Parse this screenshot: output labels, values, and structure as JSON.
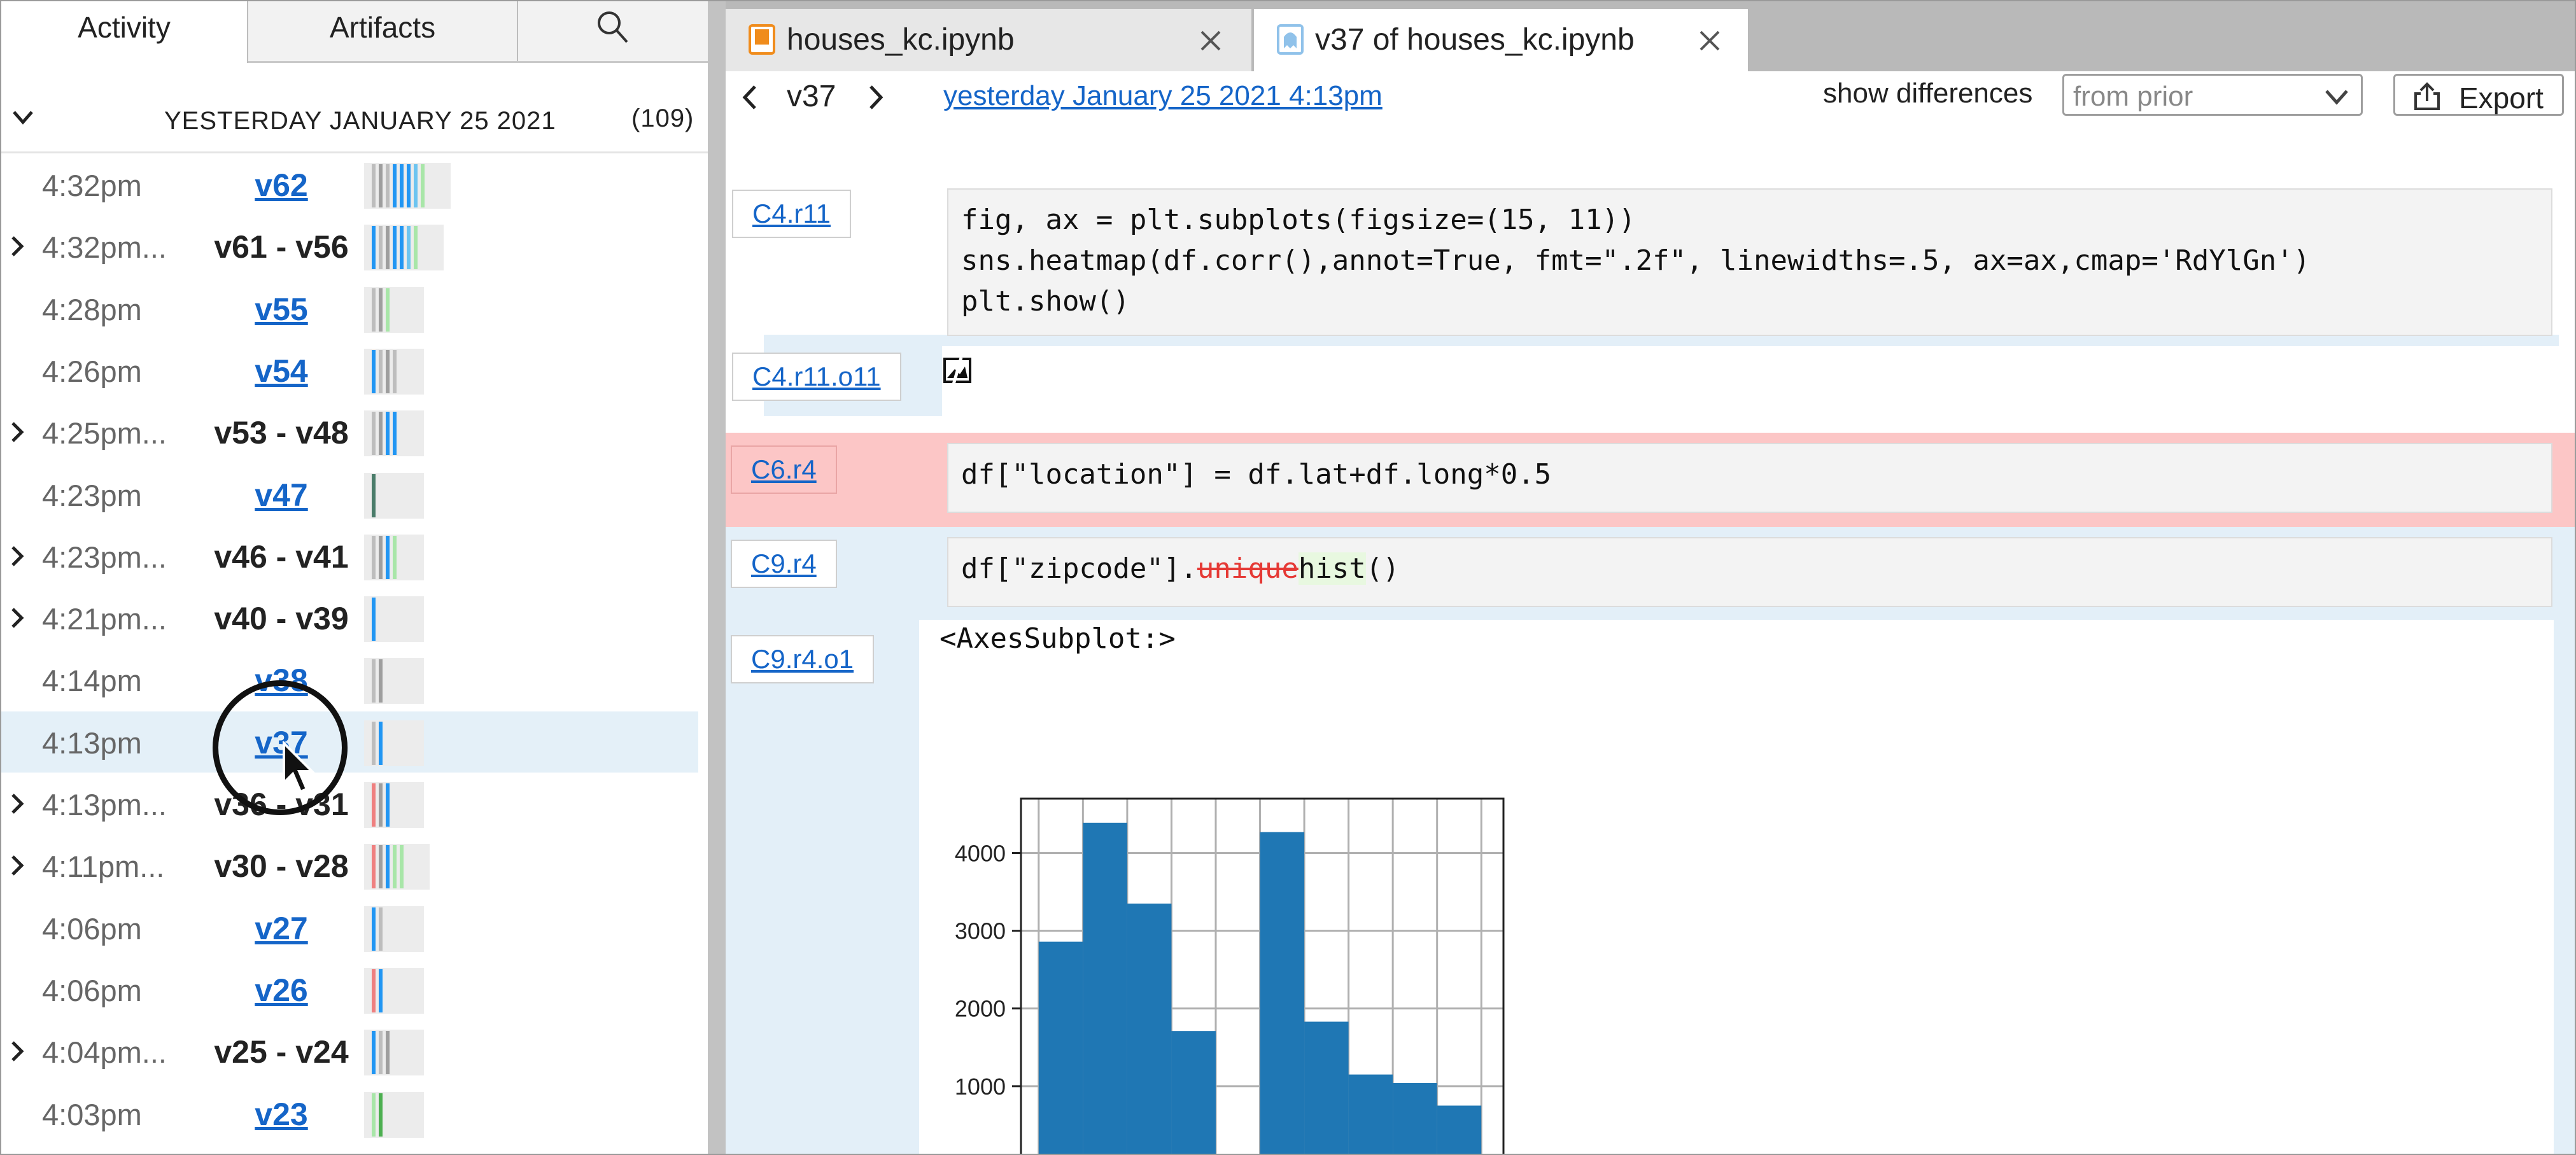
{
  "left_panel": {
    "tabs": {
      "activity": "Activity",
      "artifacts": "Artifacts",
      "search_icon": "search-icon"
    },
    "day_header": {
      "label": "YESTERDAY JANUARY 25 2021",
      "count": "(109)"
    },
    "rows": [
      {
        "time": "4:32pm",
        "version": "v62",
        "kind": "single",
        "expandable": false,
        "spark": [
          {
            "c": "#bdbdbd"
          },
          {
            "c": "#9e9e9e"
          },
          {
            "c": "#bdbdbd"
          },
          {
            "c": "#2196f3"
          },
          {
            "c": "#2196f3"
          },
          {
            "c": "#2196f3"
          },
          {
            "c": "#6cc4f0"
          },
          {
            "c": "#a8e6a8"
          }
        ]
      },
      {
        "time": "4:32pm...",
        "version": "v61 - v56",
        "kind": "range",
        "expandable": true,
        "spark": [
          {
            "c": "#2196f3"
          },
          {
            "c": "#bdbdbd"
          },
          {
            "c": "#9e9e9e"
          },
          {
            "c": "#2196f3"
          },
          {
            "c": "#2196f3"
          },
          {
            "c": "#6cc4f0"
          },
          {
            "c": "#a8e6a8"
          }
        ]
      },
      {
        "time": "4:28pm",
        "version": "v55",
        "kind": "single",
        "expandable": false,
        "spark": [
          {
            "c": "#bdbdbd"
          },
          {
            "c": "#9e9e9e"
          },
          {
            "c": "#a8e6a8"
          }
        ]
      },
      {
        "time": "4:26pm",
        "version": "v54",
        "kind": "single",
        "expandable": false,
        "spark": [
          {
            "c": "#2196f3"
          },
          {
            "c": "#bdbdbd"
          },
          {
            "c": "#9e9e9e"
          },
          {
            "c": "#bdbdbd"
          }
        ]
      },
      {
        "time": "4:25pm...",
        "version": "v53 - v48",
        "kind": "range",
        "expandable": true,
        "spark": [
          {
            "c": "#bdbdbd"
          },
          {
            "c": "#9e9e9e"
          },
          {
            "c": "#2196f3"
          },
          {
            "c": "#2196f3"
          }
        ]
      },
      {
        "time": "4:23pm",
        "version": "v47",
        "kind": "single",
        "expandable": false,
        "spark": [
          {
            "c": "#4a7c6a"
          }
        ]
      },
      {
        "time": "4:23pm...",
        "version": "v46 - v41",
        "kind": "range",
        "expandable": true,
        "spark": [
          {
            "c": "#bdbdbd"
          },
          {
            "c": "#9e9e9e"
          },
          {
            "c": "#2196f3"
          },
          {
            "c": "#a8e6a8"
          }
        ]
      },
      {
        "time": "4:21pm...",
        "version": "v40 - v39",
        "kind": "range",
        "expandable": true,
        "spark": [
          {
            "c": "#2196f3"
          }
        ]
      },
      {
        "time": "4:14pm",
        "version": "v38",
        "kind": "single",
        "expandable": false,
        "spark": [
          {
            "c": "#bdbdbd"
          },
          {
            "c": "#9e9e9e"
          }
        ]
      },
      {
        "time": "4:13pm",
        "version": "v37",
        "kind": "single",
        "expandable": false,
        "selected": true,
        "spark": [
          {
            "c": "#bdbdbd"
          },
          {
            "c": "#2196f3"
          }
        ]
      },
      {
        "time": "4:13pm...",
        "version": "v36 - v31",
        "kind": "range",
        "expandable": true,
        "spark": [
          {
            "c": "#ef8080"
          },
          {
            "c": "#9e9e9e"
          },
          {
            "c": "#2196f3"
          }
        ]
      },
      {
        "time": "4:11pm...",
        "version": "v30 - v28",
        "kind": "range",
        "expandable": true,
        "spark": [
          {
            "c": "#ef8080"
          },
          {
            "c": "#9e9e9e"
          },
          {
            "c": "#2196f3"
          },
          {
            "c": "#a8e6a8"
          },
          {
            "c": "#a8e6a8"
          }
        ]
      },
      {
        "time": "4:06pm",
        "version": "v27",
        "kind": "single",
        "expandable": false,
        "spark": [
          {
            "c": "#2196f3"
          },
          {
            "c": "#bdbdbd"
          }
        ]
      },
      {
        "time": "4:06pm",
        "version": "v26",
        "kind": "single",
        "expandable": false,
        "spark": [
          {
            "c": "#ef8080"
          },
          {
            "c": "#2196f3"
          }
        ]
      },
      {
        "time": "4:04pm...",
        "version": "v25 - v24",
        "kind": "range",
        "expandable": true,
        "spark": [
          {
            "c": "#2196f3"
          },
          {
            "c": "#bdbdbd"
          },
          {
            "c": "#9e9e9e"
          }
        ]
      },
      {
        "time": "4:03pm",
        "version": "v23",
        "kind": "single",
        "expandable": false,
        "spark": [
          {
            "c": "#a8e6a8"
          },
          {
            "c": "#4caf50"
          }
        ]
      }
    ]
  },
  "file_tabs": [
    {
      "title": "houses_kc.ipynb",
      "icon": "notebook-orange-icon",
      "close": "close-icon"
    },
    {
      "title": "v37 of houses_kc.ipynb",
      "icon": "ghost-notebook-icon",
      "close": "close-icon"
    }
  ],
  "toolbar": {
    "version": "v37",
    "date_link": "yesterday January 25 2021 4:13pm",
    "show_differences_label": "show differences",
    "diff_select_value": "from prior",
    "export_label": "Export"
  },
  "notebook": {
    "cut_text": "                                                                                  ",
    "cells": {
      "c4_label": "C4.r11",
      "c4_code": "fig, ax = plt.subplots(figsize=(15, 11))\nsns.heatmap(df.corr(),annot=True, fmt=\".2f\", linewidths=.5, ax=ax,cmap='RdYlGn')\nplt.show()",
      "c4_output_label": "C4.r11.o11",
      "c6_label": "C6.r4",
      "c6_code": "df[\"location\"] = df.lat+df.long*0.5",
      "c9_label": "C9.r4",
      "c9_code_prefix": "df[\"zipcode\"].",
      "c9_code_deleted": "unique",
      "c9_code_inserted": "hist",
      "c9_code_suffix": "()",
      "c9_output_label": "C9.r4.o1",
      "c9_output_text": "<AxesSubplot:>"
    },
    "colors": {
      "deleted_row": "#fcc6c6",
      "changed_row": "#e3eff8",
      "bar": "#1f77b4"
    }
  },
  "chart_data": {
    "type": "bar",
    "title": "",
    "xlabel": "",
    "ylabel": "",
    "yticks": [
      1000,
      2000,
      3000,
      4000
    ],
    "ylim": [
      0,
      4700
    ],
    "grid": true,
    "bins": [
      {
        "x0": 0,
        "x1": 1,
        "value": 2860
      },
      {
        "x0": 1,
        "x1": 2,
        "value": 4390
      },
      {
        "x0": 2,
        "x1": 3,
        "value": 3350
      },
      {
        "x0": 3,
        "x1": 4,
        "value": 1710
      },
      {
        "x0": 5,
        "x1": 6,
        "value": 4270
      },
      {
        "x0": 6,
        "x1": 7,
        "value": 1830
      },
      {
        "x0": 7,
        "x1": 8,
        "value": 1150
      },
      {
        "x0": 8,
        "x1": 9,
        "value": 1040
      },
      {
        "x0": 9,
        "x1": 10,
        "value": 750
      }
    ],
    "x_range": [
      -0.4,
      10.5
    ]
  }
}
